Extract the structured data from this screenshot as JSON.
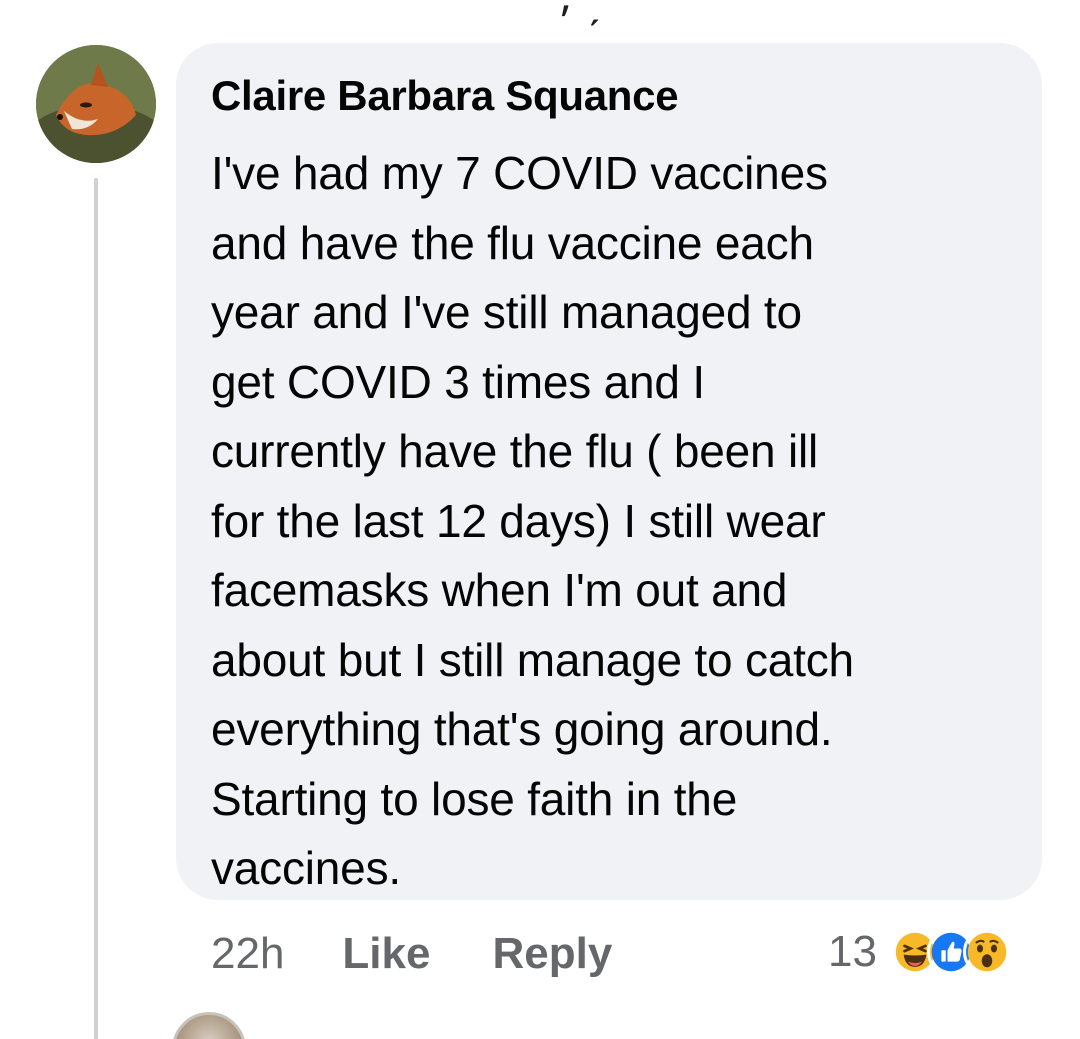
{
  "comment": {
    "author": "Claire Barbara Squance",
    "body_lines": [
      "I've had my 7 COVID vaccines",
      "and have the flu vaccine each",
      "year and I've still managed to",
      "get COVID 3 times and I",
      "currently have the flu ( been ill",
      "for the last 12 days) I still wear",
      "facemasks when I'm out and",
      "about but I still manage to catch",
      "everything that's going around.",
      "Starting to lose faith in the",
      "vaccines."
    ],
    "timestamp": "22h",
    "like_label": "Like",
    "reply_label": "Reply",
    "reaction_count": "13",
    "reactions": [
      "haha-reaction-icon",
      "like-reaction-icon",
      "wow-reaction-icon"
    ]
  },
  "colors": {
    "bubble_bg": "#f0f2f5",
    "meta_text": "#65676b",
    "like_blue": "#1877f2",
    "reaction_yellow": "#f7b928"
  }
}
